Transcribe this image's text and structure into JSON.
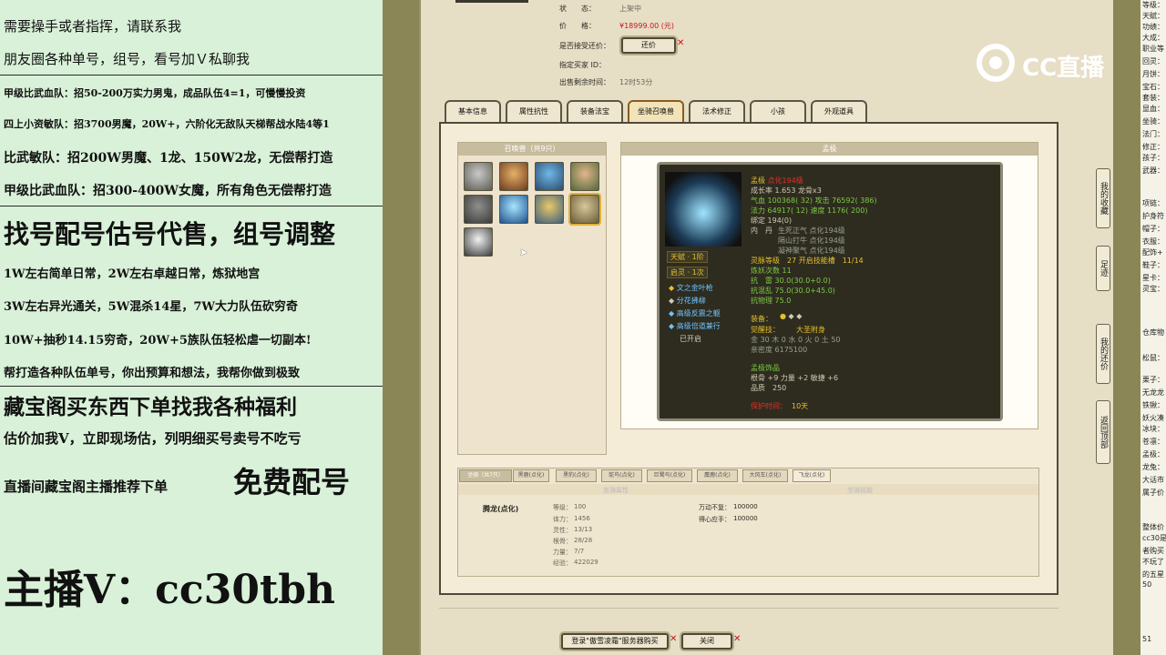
{
  "promo": {
    "lines": [
      "需要操手或者指挥，请联系我",
      "朋友圈各种单号，组号，看号加Ｖ私聊我",
      "甲级比武血队：招50-200万实力男鬼，成品队伍4=1，可慢慢投资",
      "四上小资敏队：招3700男魔，20W+，六阶化无敌队天梯帮战水陆4等1",
      "比武敏队：招200W男魔、1龙、150W2龙，无偿帮打造",
      "甲级比武血队：招300-400W女魔，所有角色无偿帮打造",
      "找号配号估号代售，组号调整",
      "1W左右简单日常，2W左右卓越日常，炼狱地宫",
      "3W左右异光通关，5W混杀14星，7W大力队伍砍穷奇",
      "10W+抽秒14.15穷奇，20W+5族队伍轻松虐一切副本!",
      "帮打造各种队伍单号，你出预算和想法，我帮你做到极致",
      "藏宝阁买东西下单找我各种福利",
      "估价加我V，立即现场估，列明细买号卖号不吃亏",
      "直播间藏宝阁主播推荐下单",
      "免费配号",
      "主播V：cc30tbh"
    ]
  },
  "info": {
    "status_label": "状　　态：",
    "status_value": "上架中",
    "price_label": "价　　格：",
    "price_value": "¥18999.00 (元)",
    "bargain_label": "是否接受还价：",
    "bargain_button": "还价",
    "buyer_label": "指定买家 ID：",
    "time_label": "出售剩余时间：",
    "time_value": "12时53分"
  },
  "tabs": [
    "基本信息",
    "属性抗性",
    "装备法宝",
    "坐骑召唤兽",
    "法术修正",
    "小孩",
    "外观道具"
  ],
  "summons": {
    "header": "召唤兽（共9只）",
    "icons": [
      "summon-wolf-icon",
      "summon-warrior-icon",
      "summon-blue-hair-icon",
      "summon-maiden-icon",
      "summon-beast-icon",
      "summon-ice-icon",
      "summon-armored-icon",
      "summon-dragon-icon",
      "summon-panda-icon"
    ]
  },
  "detail": {
    "header": "孟极",
    "name": "孟极",
    "name_suffix": "点化194级",
    "growth": "成长率 1.653 龙骨x3",
    "hp": "气血 100368( 32) 攻击 76592( 386)",
    "mp": "法力 64917( 12) 速度 1176( 200)",
    "lock": "绑定 194(0)",
    "dan1_label": "内　丹",
    "dan1": "生死正气 点化194级",
    "dan2": "隔山打牛 点化194级",
    "dan3": "凝神聚气 点化194级",
    "fate": "灵脉等级　27 开启技能槽　11/14",
    "refine": "炼妖次数 11",
    "res1": "抗　雷 30.0(30.0+0.0)",
    "res2": "抗混乱 75.0(30.0+45.0)",
    "res3": "抗物理 75.0",
    "badge1": "天赋 · 1阶",
    "badge2": "启灵 · 1次",
    "skills": [
      "文之金叶枪",
      "分花拂柳",
      "高级反震之躯",
      "高级倍道兼行",
      "已开启"
    ],
    "equip_label": "装备：",
    "skill_label": "觉醒技：",
    "skill_value": "大圣附身",
    "elements": "金 30 木 0 水 0 火 0 土 50",
    "intimacy": "亲密度 6175100",
    "ornament": "孟极饰品",
    "ornament_attr": "根骨 +9 力量 +2 敏捷 +6",
    "ornament_quality": "品质　250",
    "ban_label": "保护时间：",
    "ban_value": "10天"
  },
  "mounts": {
    "tabs": [
      "坐骑（共7只）",
      "黑鹿(点化)",
      "黑豹(点化)",
      "鸵鸟(点化)",
      "巨鹭鸟(点化)",
      "麋鹿(点化)",
      "大风车(点化)",
      "飞龙(点化)"
    ],
    "col1": "坐骑属性",
    "col2": "坐骑技能",
    "name": "腾龙(点化)",
    "stats_labels": [
      "等级：",
      "体力：",
      "灵性：",
      "根骨：",
      "力量：",
      "经验："
    ],
    "stats_values": [
      "100",
      "1456",
      "13/13",
      "28/28",
      "7/7",
      "422029"
    ],
    "skill1": "万动不复：",
    "skill1_value": "100000",
    "skill2": "得心应手：",
    "skill2_value": "100000"
  },
  "buttons": {
    "login": "登录\"傲雪凌霜\"服务器购买",
    "close": "关闭"
  },
  "side": {
    "collect": "我的收藏",
    "footprint": "足迹",
    "my_bargain": "我的还价",
    "top": "返回顶部"
  },
  "logo": {
    "text": "CC直播"
  },
  "chat": {
    "lines": [
      "等级：",
      "天赋：",
      "功绩：",
      "大成：",
      "职业等",
      "回灵：",
      "月饼：",
      "宝石：",
      "套装：",
      "显血：",
      "坐骑：",
      "法门：",
      "修正：",
      "孩子：",
      "武器：",
      "项链：",
      "护身符",
      "帽子：",
      "衣服：",
      "配饰+",
      "鞋子：",
      "星卡：",
      "灵宝：",
      "仓库物",
      "松鼠：",
      "栗子：",
      "无龙龙",
      "铁锹：",
      "妖火凑",
      "冰块：",
      "苍凛：",
      "孟极：",
      "龙兔：",
      "大话市",
      "属子价",
      "整体价",
      "cc30是",
      "者购买",
      "不玩了",
      "的五星",
      "50",
      "51"
    ]
  }
}
